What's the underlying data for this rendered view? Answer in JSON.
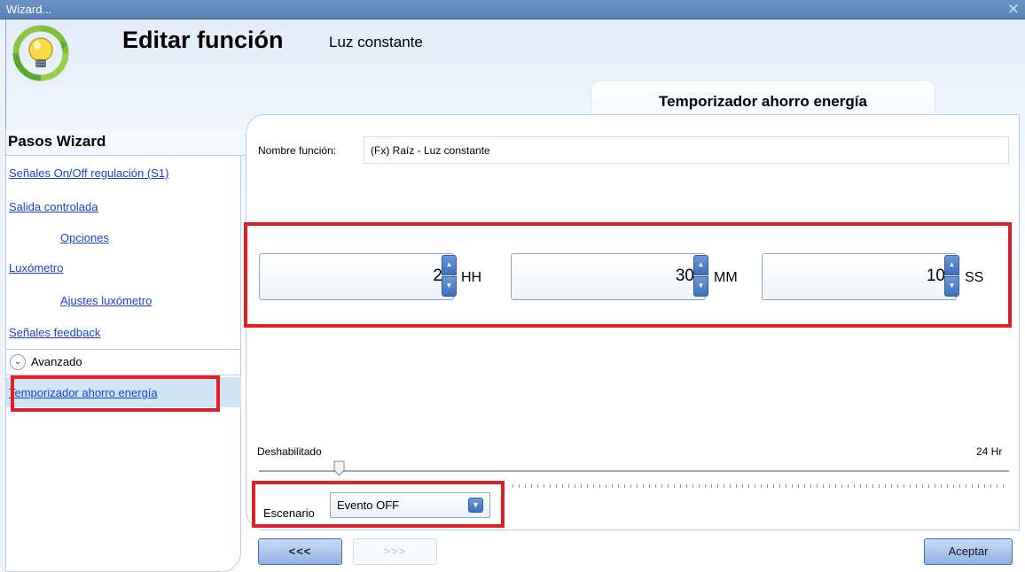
{
  "window": {
    "title": "Wizard...",
    "close_glyph": "✕"
  },
  "header": {
    "title": "Editar función",
    "subtitle": "Luz constante",
    "logo_icon": "lightbulb-energy-icon"
  },
  "step_tab": {
    "label": "Temporizador ahorro energía"
  },
  "sidebar": {
    "title": "Pasos Wizard",
    "items": [
      {
        "label": "Señales On/Off regulación (S1)"
      },
      {
        "label": "Salida controlada"
      },
      {
        "label": "Opciones"
      },
      {
        "label": "Luxómetro"
      },
      {
        "label": "Ajustes luxómetro"
      },
      {
        "label": "Señales feedback"
      }
    ],
    "advanced": {
      "label": "Avanzado",
      "icon": "chevron-down-circle-icon"
    },
    "active_item": {
      "label": "Temporizador ahorro energía"
    }
  },
  "form": {
    "name_label": "Nombre función:",
    "name_value": "(Fx) Raíz - Luz constante"
  },
  "timer": {
    "hours": {
      "value": "2",
      "unit": "HH"
    },
    "minutes": {
      "value": "30",
      "unit": "MM"
    },
    "seconds": {
      "value": "10",
      "unit": "SS"
    }
  },
  "slider": {
    "min_label": "Deshabilitado",
    "max_label": "24 Hr"
  },
  "scenario": {
    "label": "Escenario",
    "selected": "Evento OFF"
  },
  "buttons": {
    "back": "<<<",
    "next": ">>>",
    "accept": "Aceptar"
  },
  "colors": {
    "highlight_box": "#e01f27",
    "title_bar": "#5a82b6",
    "active_bg": "#cfe5f4",
    "link": "#1a3fd9"
  }
}
